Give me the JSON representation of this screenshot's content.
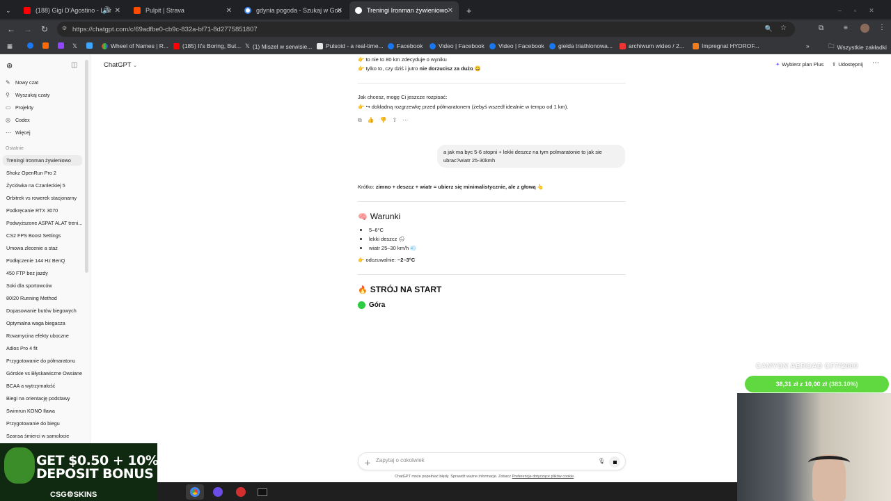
{
  "browser": {
    "tabs": [
      {
        "title": "(188) Gigi D'Agostino - L'Ar",
        "color": "#ff0000",
        "active": false
      },
      {
        "title": "Pulpit | Strava",
        "color": "#fc4c02",
        "active": false
      },
      {
        "title": "gdynia pogoda - Szukaj w Goo",
        "color": "#4285f4",
        "active": false
      },
      {
        "title": "Treningi Ironman żywieniowo",
        "color": "#ffffff",
        "active": true
      }
    ],
    "url": "https://chatgpt.com/c/69adfbe0-cb9c-832a-bf71-8d2775851807",
    "bookmarks": [
      "Wheel of Names | R...",
      "(185) It's Boring, But...",
      "(1) Miszel w serwisie...",
      "Pulsoid - a real-time...",
      "Facebook",
      "Video | Facebook",
      "Video | Facebook",
      "giełda triathlonowa...",
      "archiwum wideo / 2...",
      "Impregnat HYDROF...",
      "Wszystkie zakładki"
    ]
  },
  "sidebar": {
    "menu": [
      {
        "label": "Nowy czat",
        "icon": "edit-icon"
      },
      {
        "label": "Wyszukaj czaty",
        "icon": "search-icon"
      },
      {
        "label": "Projekty",
        "icon": "folder-icon"
      },
      {
        "label": "Codex",
        "icon": "codex-icon"
      },
      {
        "label": "Więcej",
        "icon": "more-icon"
      }
    ],
    "section_label": "Ostatnie",
    "chats": [
      "Treningi Ironman żywieniowo",
      "Shokz OpenRun Pro 2",
      "Życiówka na Czanleckiej 5",
      "Orbitrek vs rowerek stacjonarny",
      "Podkręcanie RTX 3070",
      "Podwyższone ASPAT ALAT treni...",
      "CS2 FPS Boost Settings",
      "Umowa zlecenie a staż",
      "Podłączenie 144 Hz BenQ",
      "450 FTP bez jazdy",
      "Soki dla sportowców",
      "80/20 Running Method",
      "Dopasowanie butów biegowych",
      "Optymalna waga biegacza",
      "Rovamycina efekty uboczne",
      "Adios Pro 4 fit",
      "Przygotowanie do półmaratonu",
      "Górskie vs Błyskawiczne Owsiane",
      "BCAA a wytrzymałość",
      "Biegi na orientację podstawy",
      "Swimrun KONO Iława",
      "Przygotowanie do biegu",
      "Szansa śmierci w samolocie"
    ]
  },
  "header": {
    "model": "ChatGPT",
    "upgrade": "Wybierz plan Plus",
    "share": "Udostępnij"
  },
  "conversation": {
    "prev_line1": "to nie to 80 km zdecyduje o wyniku",
    "prev_line2_pre": "tylko to, czy dziś i jutro ",
    "prev_line2_bold": "nie dorzucisz za dużo",
    "offer_line": "Jak chcesz, mogę Ci jeszcze rozpisać:",
    "offer_item": "↪ dokładną rozgrzewkę przed półmaratonem (żebyś wszedł idealnie w tempo od 1 km).",
    "user_message": "a jak ma byc 5-6 stopni + lekki deszcz na tym polmaratonie to jak sie ubrac?wiatr 25-30kmh",
    "short_label": "Krótko: ",
    "short_bold": "zimno + deszcz + wiatr = ubierz się minimalistycznie, ale z głową",
    "conditions_title": "Warunki",
    "conditions": [
      "5–6°C",
      "lekki deszcz 🌧",
      "wiatr 25–30 km/h 💨"
    ],
    "feels_label": "odczuwalnie: ",
    "feels_value": "~2–3°C",
    "outfit_title": "STRÓJ NA START",
    "top_title": "Góra"
  },
  "composer": {
    "placeholder": "Zapytaj o cokolwiek",
    "disclaimer": "ChatGPT może popełniać błędy. Sprawdź ważne informacje. Zobacz ",
    "disclaimer_link": "Preferencje dotyczące plików cookie",
    "disclaimer_end": "."
  },
  "overlay": {
    "ad_line1": "GET $0.50 + 10%",
    "ad_line2": "DEPOSIT BONUS",
    "ad_brand": "CSG⚙SKINS",
    "goal_title": "CANYON AEROAD CF7/2000",
    "goal_amount": "38,31 zł z 10,00 zł",
    "goal_percent": "(383.10%)"
  },
  "colors": {
    "accent_purple": "#7b5cff",
    "goal_green": "#5fd93f"
  }
}
